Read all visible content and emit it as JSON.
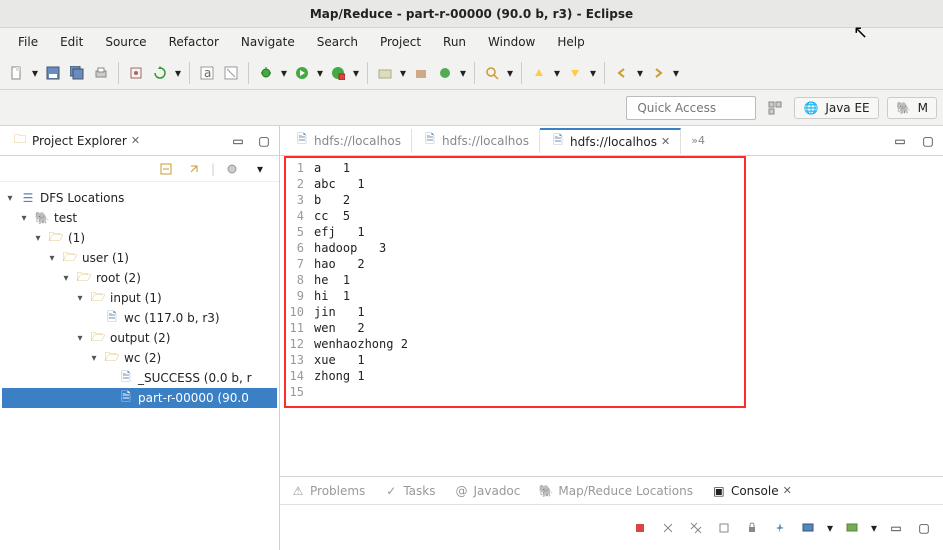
{
  "title": "Map/Reduce - part-r-00000 (90.0 b, r3) - Eclipse",
  "menu": [
    "File",
    "Edit",
    "Source",
    "Refactor",
    "Navigate",
    "Search",
    "Project",
    "Run",
    "Window",
    "Help"
  ],
  "quick_access_placeholder": "Quick Access",
  "perspective": {
    "java_ee": "Java EE",
    "mapreduce": "M"
  },
  "project_explorer": {
    "title": "Project Explorer"
  },
  "tree": {
    "dfs": "DFS Locations",
    "test": "test",
    "n1": "(1)",
    "user": "user (1)",
    "root": "root (2)",
    "input": "input (1)",
    "wc_in": "wc (117.0 b, r3)",
    "output": "output (2)",
    "wc_out": "wc (2)",
    "success": "_SUCCESS (0.0 b, r",
    "partr": "part-r-00000 (90.0"
  },
  "editor_tabs": {
    "t1": "hdfs://localhos",
    "t2": "hdfs://localhos",
    "t3": "hdfs://localhos",
    "overflow": "»4"
  },
  "editor_lines": [
    "a   1",
    "abc   1",
    "b   2",
    "cc  5",
    "efj   1",
    "hadoop   3",
    "hao   2",
    "he  1",
    "hi  1",
    "jin   1",
    "wen   2",
    "wenhaozhong 2",
    "xue   1",
    "zhong 1",
    ""
  ],
  "bottom_tabs": {
    "problems": "Problems",
    "tasks": "Tasks",
    "javadoc": "Javadoc",
    "mrloc": "Map/Reduce Locations",
    "console": "Console"
  }
}
